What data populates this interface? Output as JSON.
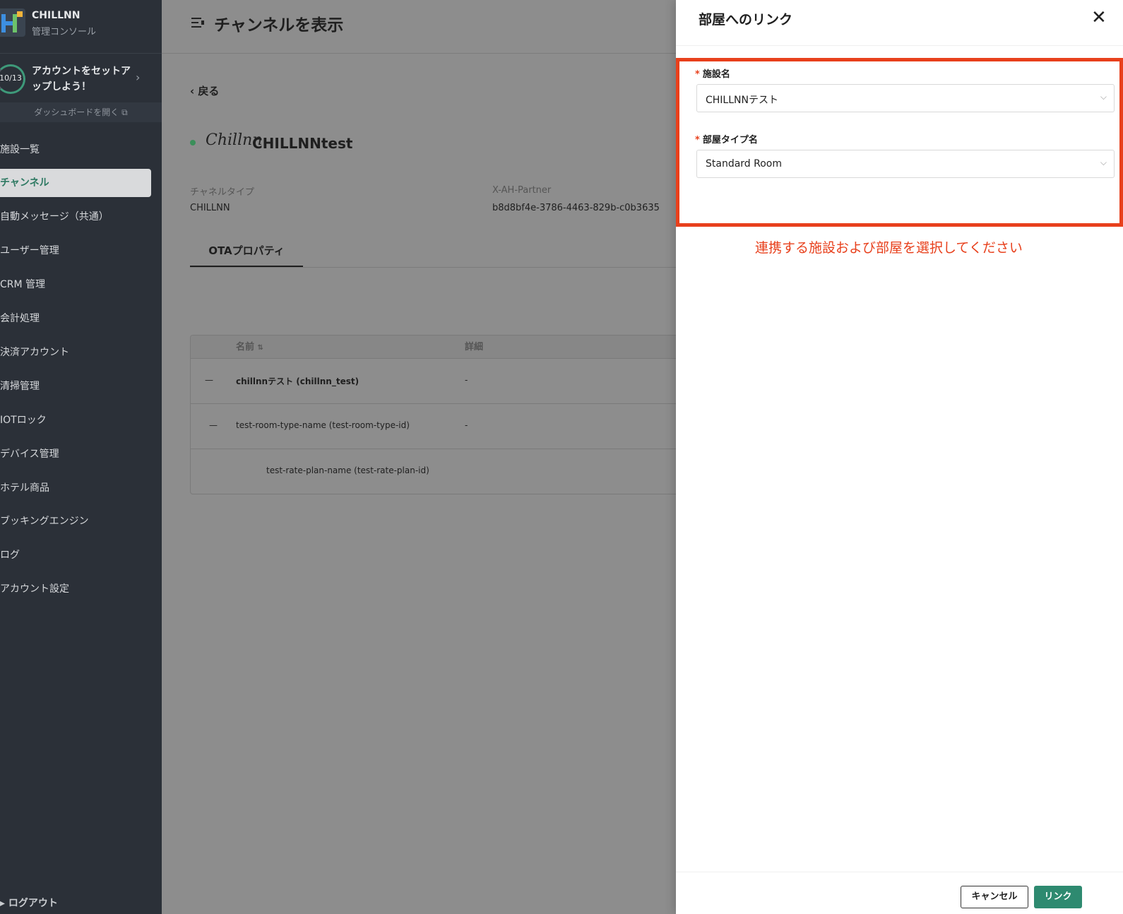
{
  "sidebar": {
    "brand_name": "CHILLNN",
    "brand_sub": "管理コンソール",
    "setup_progress": "10/13",
    "setup_text": "アカウントをセットアップしよう！",
    "dashboard_link": "ダッシュボードを開く",
    "items": [
      {
        "label": "施設一覧"
      },
      {
        "label": "チャンネル"
      },
      {
        "label": "自動メッセージ（共通）"
      },
      {
        "label": "ユーザー管理"
      },
      {
        "label": "CRM 管理"
      },
      {
        "label": "会計処理"
      },
      {
        "label": "決済アカウント"
      },
      {
        "label": "清掃管理"
      },
      {
        "label": "IOTロック"
      },
      {
        "label": "デバイス管理"
      },
      {
        "label": "ホテル商品"
      },
      {
        "label": "ブッキングエンジン"
      },
      {
        "label": "ログ"
      },
      {
        "label": "アカウント設定"
      }
    ],
    "logout": "ログアウト"
  },
  "main": {
    "title": "チャンネルを表示",
    "back": "戻る",
    "logo_text": "Chillnn",
    "channel_name": "CHILLNNtest",
    "fields": {
      "channel_type_label": "チャネルタイプ",
      "channel_type_value": "CHILLNN",
      "partner_label": "X-AH-Partner",
      "partner_value": "b8d8bf4e-3786-4463-829b-c0b3635"
    },
    "tab": "OTAプロパティ",
    "table": {
      "headers": {
        "name": "名前",
        "detail": "詳細"
      },
      "rows": [
        {
          "expand": "—",
          "name": "chillnnテスト (chillnn_test)",
          "detail": "-"
        },
        {
          "expand": "—",
          "name": "test-room-type-name (test-room-type-id)",
          "detail": "-"
        },
        {
          "expand": "",
          "name": "test-rate-plan-name (test-rate-plan-id)",
          "detail": ""
        }
      ]
    }
  },
  "drawer": {
    "title": "部屋へのリンク",
    "facility_label": "施設名",
    "facility_value": "CHILLNNテスト",
    "room_type_label": "部屋タイプ名",
    "room_type_value": "Standard Room",
    "annotation": "連携する施設および部屋を選択してください",
    "cancel": "キャンセル",
    "link": "リンク"
  },
  "colors": {
    "accent": "#2e8a70",
    "highlight": "#e8401c",
    "sidebar": "#2b3038"
  }
}
